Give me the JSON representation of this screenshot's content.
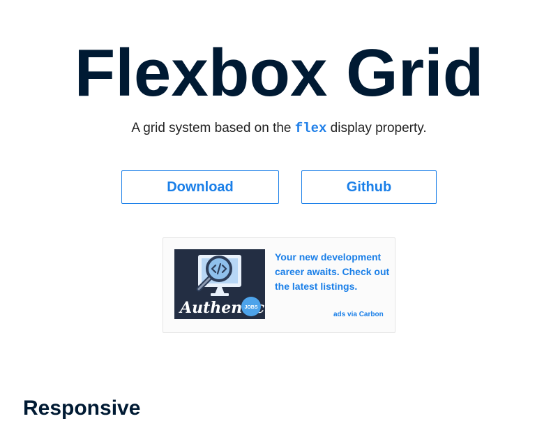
{
  "hero": {
    "title": "Flexbox Grid",
    "subtitle_before": "A grid system based on the ",
    "subtitle_code": "flex",
    "subtitle_after": " display property."
  },
  "actions": {
    "download_label": "Download",
    "github_label": "Github"
  },
  "ad": {
    "text": "Your new development career awaits. Check out the latest listings.",
    "via": "ads via Carbon",
    "image_brand_text": "Authentic",
    "image_badge_text": "JOBS"
  },
  "section": {
    "title": "Responsive"
  },
  "colors": {
    "title": "#001a33",
    "accent": "#1a7fe8",
    "ad_image_bg": "#232e43",
    "lower_bg": "#eeeeee"
  },
  "icons": {
    "ad_image": "magnifier-over-code-monitor-icon"
  }
}
